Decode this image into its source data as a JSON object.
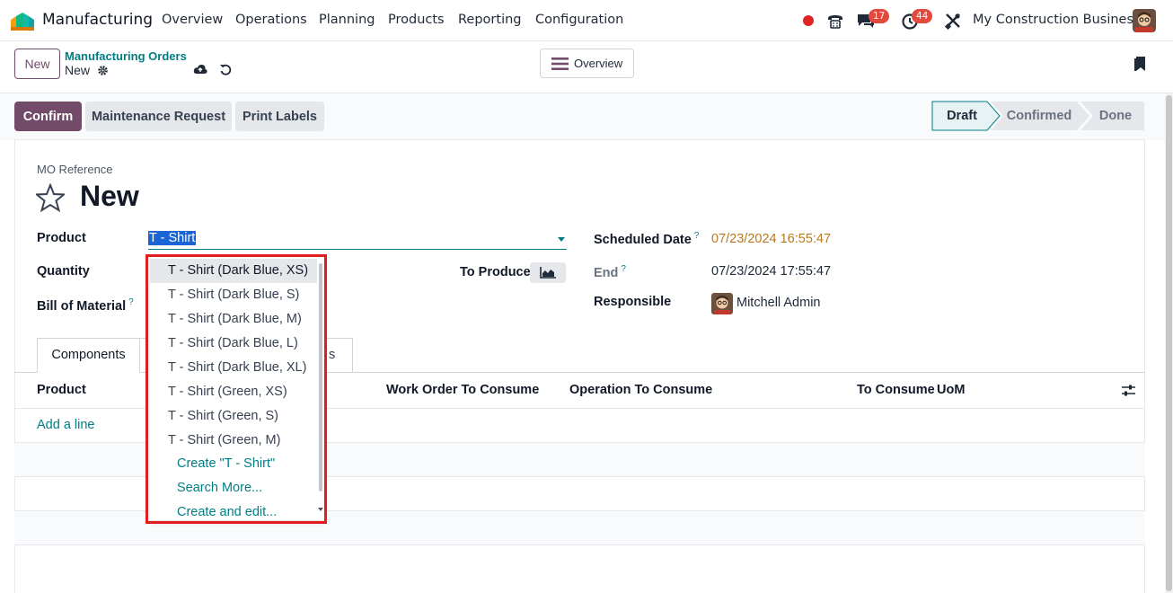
{
  "navbar": {
    "app_name": "Manufacturing",
    "menu": [
      "Overview",
      "Operations",
      "Planning",
      "Products",
      "Reporting",
      "Configuration"
    ],
    "chat_count": "17",
    "activity_count": "44",
    "company": "My Construction Business"
  },
  "control_panel": {
    "new_label": "New",
    "breadcrumb": "Manufacturing Orders",
    "record_name": "New",
    "overview_label": "Overview"
  },
  "actions": {
    "confirm": "Confirm",
    "maintenance": "Maintenance Request",
    "print": "Print Labels"
  },
  "statusbar": {
    "draft": "Draft",
    "confirmed": "Confirmed",
    "done": "Done"
  },
  "form": {
    "ref_label": "MO Reference",
    "title": "New",
    "product_label": "Product",
    "product_value": "T - Shirt",
    "quantity_label": "Quantity",
    "to_produce_label": "To Produce",
    "bom_label": "Bill of Material",
    "help_mark": "?",
    "scheduled_label": "Scheduled Date",
    "scheduled_value": "07/23/2024 16:55:47",
    "end_label": "End",
    "end_value": "07/23/2024 17:55:47",
    "responsible_label": "Responsible",
    "responsible_value": "Mitchell Admin"
  },
  "tabs": {
    "components": "Components",
    "other_visible_fragment": "s"
  },
  "table": {
    "headers": [
      "Product",
      "Work Order To Consume",
      "Operation To Consume",
      "To Consume",
      "UoM"
    ],
    "add_line": "Add a line"
  },
  "dropdown": {
    "items": [
      "T - Shirt (Dark Blue, XS)",
      "T - Shirt (Dark Blue, S)",
      "T - Shirt (Dark Blue, M)",
      "T - Shirt (Dark Blue, L)",
      "T - Shirt (Dark Blue, XL)",
      "T - Shirt (Green, XS)",
      "T - Shirt (Green, S)",
      "T - Shirt (Green, M)"
    ],
    "create": "Create \"T - Shirt\"",
    "search_more": "Search More...",
    "create_edit": "Create and edit..."
  },
  "colors": {
    "brand": "#714b67",
    "link": "#017e84",
    "highlight": "#e11d1d"
  }
}
